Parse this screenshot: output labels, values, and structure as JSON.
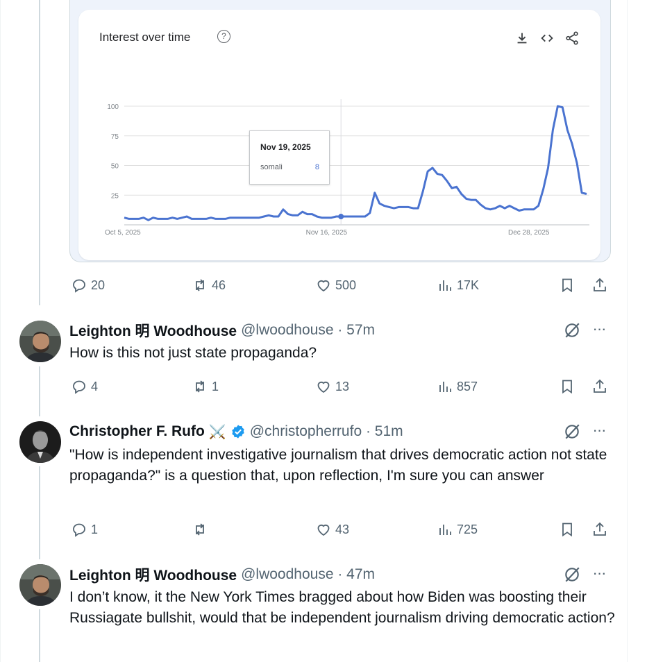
{
  "trends": {
    "title": "Interest over time",
    "help_glyph": "?",
    "tooltip": {
      "date": "Nov 19, 2025",
      "term": "somali",
      "value": "8"
    },
    "accent": "#4a73d0"
  },
  "chart_data": {
    "type": "line",
    "title": "Interest over time",
    "x_ticks": [
      "Oct 5, 2025",
      "Nov 16, 2025",
      "Dec 28, 2025"
    ],
    "y_ticks": [
      "100",
      "75",
      "50",
      "25"
    ],
    "ylim": [
      0,
      100
    ],
    "grid": true,
    "series": [
      {
        "name": "somali",
        "color": "#4a73d0",
        "x_start": "Oct 5, 2025",
        "x_step_days": 1,
        "values": [
          6,
          5,
          5,
          5,
          6,
          4,
          6,
          5,
          5,
          5,
          6,
          5,
          6,
          7,
          5,
          5,
          5,
          5,
          6,
          5,
          5,
          5,
          6,
          6,
          6,
          6,
          6,
          6,
          6,
          7,
          8,
          7,
          7,
          13,
          9,
          8,
          8,
          11,
          9,
          9,
          7,
          6,
          6,
          6,
          7,
          7,
          7,
          7,
          7,
          7,
          7,
          10,
          27,
          18,
          16,
          15,
          14,
          15,
          15,
          15,
          14,
          14,
          28,
          45,
          48,
          43,
          42,
          37,
          31,
          32,
          26,
          22,
          21,
          21,
          17,
          14,
          13,
          14,
          16,
          14,
          16,
          14,
          12,
          13,
          13,
          13,
          16,
          30,
          48,
          80,
          100,
          99,
          80,
          68,
          52,
          27,
          26
        ]
      }
    ]
  },
  "tweet0": {
    "actions": {
      "replies": "20",
      "reposts": "46",
      "likes": "500",
      "views": "17K"
    }
  },
  "posts": [
    {
      "name": "Leighton 明 Woodhouse",
      "handle": "@lwoodhouse · 57m",
      "text": "How is this not just state propaganda?",
      "actions": {
        "replies": "4",
        "reposts": "1",
        "likes": "13",
        "views": "857"
      }
    },
    {
      "name": "Christopher F. Rufo",
      "name_emoji": "⚔️",
      "handle": "@christopherrufo · 51m",
      "text": "\"How is independent investigative journalism that drives democratic action not state propaganda?\" is a question that, upon reflection, I'm sure you can answer",
      "actions": {
        "replies": "1",
        "reposts": "",
        "likes": "43",
        "views": "725"
      }
    },
    {
      "name": "Leighton 明 Woodhouse",
      "handle": "@lwoodhouse · 47m",
      "text": "I don’t know, it the New York Times bragged about how Biden was boosting their Russiagate bullshit, would that be independent journalism driving democratic action?"
    }
  ],
  "more_glyph": "···",
  "colors": {
    "text": "#0f1419",
    "secondary": "#536471",
    "verified": "#1d9bf0",
    "line": "#cfd9de"
  }
}
